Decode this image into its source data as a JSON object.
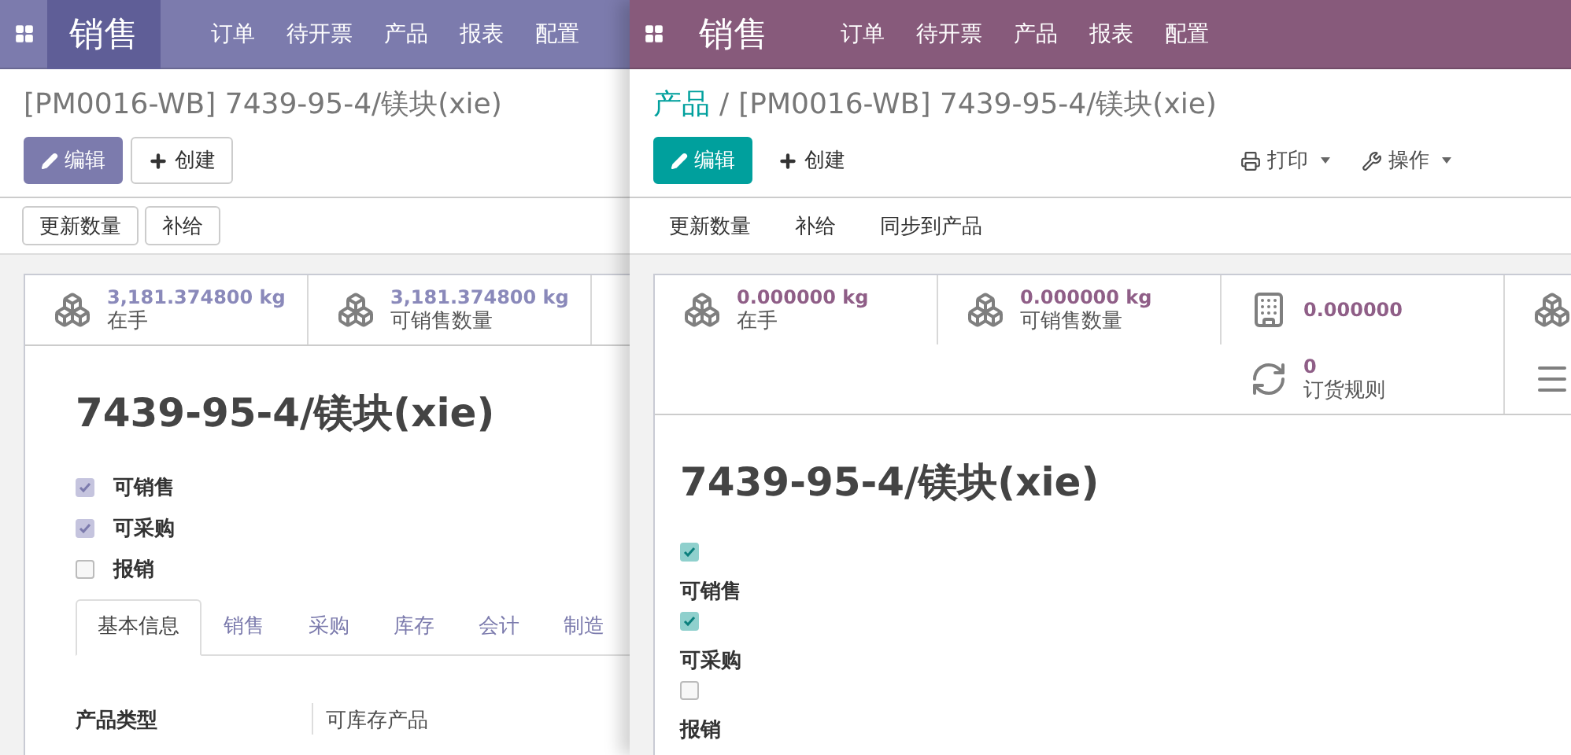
{
  "windows": [
    {
      "kind": "muted",
      "color": "#7c7bad",
      "app": "销售",
      "menu": [
        "订单",
        "待开票",
        "产品",
        "报表",
        "配置"
      ],
      "title": "[PM0016-WB] 7439-95-4/镁块(xie)",
      "buttons": [
        {
          "kind": "edit",
          "label": "编辑"
        },
        {
          "kind": "create",
          "label": "创建"
        }
      ],
      "actions": [
        "更新数量",
        "补给"
      ],
      "stat_rows": [
        [
          {
            "kind": "stock",
            "value": "3,181.374800 kg",
            "label": "在手"
          },
          {
            "kind": "stock",
            "value": "3,181.374800 kg",
            "label": "可销售数量"
          }
        ]
      ],
      "name": "7439-95-4/镁块(xie)",
      "checkboxes": [
        {
          "label": "可销售",
          "checked": true
        },
        {
          "label": "可采购",
          "checked": true
        },
        {
          "label": "报销",
          "checked": false
        }
      ],
      "tabs": [
        {
          "label": "基本信息",
          "selected": true
        },
        {
          "label": "销售",
          "selected": false
        },
        {
          "label": "采购",
          "selected": false
        },
        {
          "label": "库存",
          "selected": false
        },
        {
          "label": "会计",
          "selected": false
        },
        {
          "label": "制造",
          "selected": false
        }
      ],
      "fields": [
        {
          "label": "产品类型",
          "value": "可库存产品"
        }
      ]
    },
    {
      "kind": "standard",
      "color": "#875a7b",
      "app": "销售",
      "menu": [
        "订单",
        "待开票",
        "产品",
        "报表",
        "配置"
      ],
      "breadcrumb": [
        "产品"
      ],
      "separator": "/",
      "title": "[PM0016-WB] 7439-95-4/镁块(xie)",
      "buttons": [
        {
          "kind": "edit",
          "label": "编辑"
        },
        {
          "kind": "create",
          "label": "创建"
        }
      ],
      "dropdowns": [
        {
          "kind": "print",
          "label": "打印"
        },
        {
          "kind": "action",
          "label": "操作"
        }
      ],
      "actions": [
        "更新数量",
        "补给",
        "同步到产品"
      ],
      "stat_rows": [
        [
          {
            "kind": "stock",
            "value": "0.000000 kg",
            "label": "在手"
          },
          {
            "kind": "stock",
            "value": "0.000000 kg",
            "label": "可销售数量"
          },
          {
            "kind": "site",
            "value": "0.000000"
          },
          {
            "kind": "stock"
          }
        ],
        [
          {
            "kind": "rule",
            "value": "0",
            "label": "订货规则"
          },
          {
            "kind": "more"
          }
        ]
      ],
      "name": "7439-95-4/镁块(xie)",
      "checkboxes": [
        {
          "label": "可销售",
          "checked": true
        },
        {
          "label": "可采购",
          "checked": true
        },
        {
          "label": "报销",
          "checked": false
        }
      ]
    }
  ]
}
